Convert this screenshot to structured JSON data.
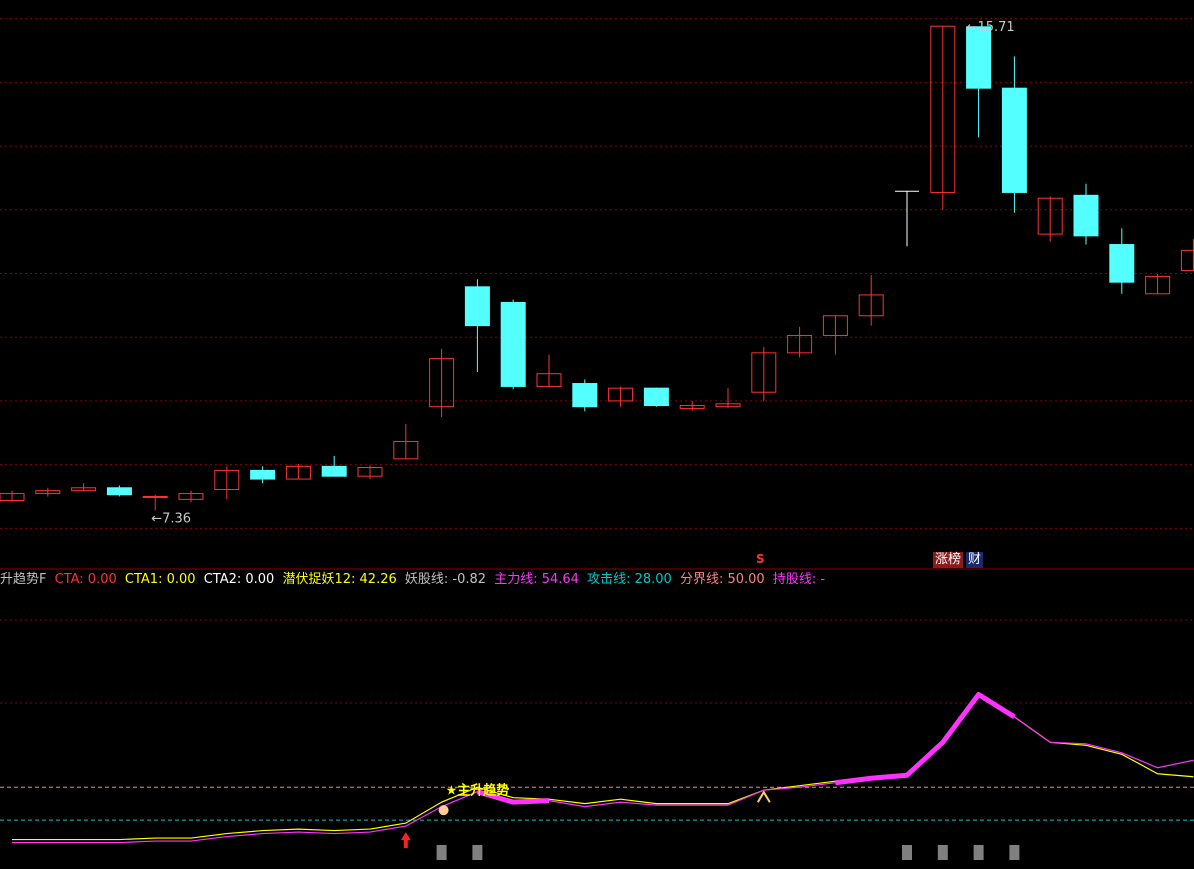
{
  "chart_data": [
    {
      "type": "candlestick",
      "ylim": [
        6.9,
        16.0
      ],
      "y_gridlines": [
        7.05,
        8.15,
        9.25,
        10.35,
        11.45,
        12.55,
        13.65,
        14.75,
        15.85
      ],
      "candles": [
        {
          "open": 7.53,
          "close": 7.65,
          "high": 7.7,
          "low": 7.5
        },
        {
          "open": 7.65,
          "close": 7.7,
          "high": 7.75,
          "low": 7.6
        },
        {
          "open": 7.7,
          "close": 7.75,
          "high": 7.83,
          "low": 7.7
        },
        {
          "open": 7.75,
          "close": 7.63,
          "high": 7.79,
          "low": 7.6
        },
        {
          "open": 7.6,
          "close": 7.6,
          "high": 7.63,
          "low": 7.36
        },
        {
          "open": 7.55,
          "close": 7.65,
          "high": 7.7,
          "low": 7.5
        },
        {
          "open": 7.72,
          "close": 8.05,
          "high": 8.12,
          "low": 7.55
        },
        {
          "open": 8.05,
          "close": 7.9,
          "high": 8.12,
          "low": 7.83
        },
        {
          "open": 7.9,
          "close": 8.12,
          "high": 8.16,
          "low": 7.9
        },
        {
          "open": 8.12,
          "close": 7.95,
          "high": 8.3,
          "low": 7.95
        },
        {
          "open": 7.95,
          "close": 8.1,
          "high": 8.14,
          "low": 7.9
        },
        {
          "open": 8.25,
          "close": 8.55,
          "high": 8.85,
          "low": 8.25
        },
        {
          "open": 9.15,
          "close": 9.98,
          "high": 10.15,
          "low": 8.97
        },
        {
          "open": 11.22,
          "close": 10.55,
          "high": 11.35,
          "low": 9.75
        },
        {
          "open": 10.95,
          "close": 9.5,
          "high": 11.0,
          "low": 9.45
        },
        {
          "open": 9.5,
          "close": 9.72,
          "high": 10.05,
          "low": 9.5
        },
        {
          "open": 9.55,
          "close": 9.15,
          "high": 9.62,
          "low": 9.07
        },
        {
          "open": 9.25,
          "close": 9.47,
          "high": 9.5,
          "low": 9.15
        },
        {
          "open": 9.47,
          "close": 9.17,
          "high": 9.48,
          "low": 9.15
        },
        {
          "open": 9.12,
          "close": 9.17,
          "high": 9.25,
          "low": 9.08
        },
        {
          "open": 9.15,
          "close": 9.2,
          "high": 9.47,
          "low": 9.13
        },
        {
          "open": 9.4,
          "close": 10.08,
          "high": 10.18,
          "low": 9.25
        },
        {
          "open": 10.08,
          "close": 10.38,
          "high": 10.53,
          "low": 10.0
        },
        {
          "open": 10.38,
          "close": 10.72,
          "high": 10.72,
          "low": 10.05
        },
        {
          "open": 10.72,
          "close": 11.08,
          "high": 11.42,
          "low": 10.55
        },
        {
          "open": 12.87,
          "close": 12.87,
          "high": 12.87,
          "low": 11.92
        },
        {
          "open": 12.85,
          "close": 15.72,
          "high": 15.72,
          "low": 12.55
        },
        {
          "open": 15.71,
          "close": 14.65,
          "high": 15.71,
          "low": 13.8
        },
        {
          "open": 14.65,
          "close": 12.85,
          "high": 15.2,
          "low": 12.5
        },
        {
          "open": 12.13,
          "close": 12.75,
          "high": 12.78,
          "low": 12.0
        },
        {
          "open": 12.8,
          "close": 12.1,
          "high": 13.0,
          "low": 11.95
        },
        {
          "open": 11.95,
          "close": 11.3,
          "high": 12.23,
          "low": 11.1
        },
        {
          "open": 11.1,
          "close": 11.4,
          "high": 11.44,
          "low": 11.1
        },
        {
          "open": 11.5,
          "close": 11.85,
          "high": 12.05,
          "low": 11.5
        }
      ],
      "annotations": [
        {
          "text": "←7.36",
          "candle": 4,
          "value": 7.36
        },
        {
          "text": "←15.71",
          "candle": 27,
          "value": 15.71
        }
      ],
      "colors": {
        "up": "#ff3232",
        "down": "#54ffff",
        "doji": "#ffffff",
        "grid": "#8b0000"
      }
    },
    {
      "type": "line",
      "ylim": [
        0,
        100
      ],
      "reference_lines": [
        {
          "name": "攻击线",
          "value": 28.0,
          "color": "#00c8c8"
        },
        {
          "name": "分界线",
          "value": 50.0,
          "color": "#ff8080"
        }
      ],
      "series": [
        {
          "name": "潜伏捉妖12",
          "color": "#ffff00",
          "values": [
            15,
            15,
            15,
            15,
            16,
            16,
            19,
            21,
            22,
            21,
            22,
            26,
            40,
            50,
            43,
            42,
            39,
            42,
            39,
            39,
            39,
            48,
            51,
            54,
            56,
            58,
            80,
            111,
            97,
            80,
            78,
            72,
            59,
            57
          ]
        },
        {
          "name": "主力线",
          "color": "#ff32ff",
          "values": [
            13,
            13,
            13,
            13,
            14,
            14,
            17,
            19,
            20,
            19,
            20,
            24,
            37,
            47,
            40,
            41,
            37,
            40,
            38,
            38,
            38,
            48,
            50,
            53,
            56,
            58,
            80,
            112,
            97,
            80,
            79,
            73,
            63,
            68
          ]
        }
      ],
      "bold_segments": [
        [
          13,
          15
        ],
        [
          23,
          28
        ]
      ],
      "signals": [
        {
          "text": "★主升趋势",
          "candle": 12,
          "color": "#ffff00"
        }
      ],
      "bars": [
        12,
        13,
        25,
        26,
        27,
        28
      ]
    }
  ],
  "indicator_bar": {
    "name": "升趋势F",
    "items": [
      {
        "label": "CTA: 0.00",
        "color": "#ff3232"
      },
      {
        "label": "CTA1: 0.00",
        "color": "#ffff00"
      },
      {
        "label": "CTA2: 0.00",
        "color": "#ffffff"
      },
      {
        "label": "潜伏捉妖12: 42.26",
        "color": "#ffff00"
      },
      {
        "label": "妖股线: -0.82",
        "color": "#c0c0c0"
      },
      {
        "label": "主力线: 54.64",
        "color": "#ff32ff"
      },
      {
        "label": "攻击线: 28.00",
        "color": "#00c8c8"
      },
      {
        "label": "分界线: 50.00",
        "color": "#ff8080"
      },
      {
        "label": "持股线: -",
        "color": "#ff32ff"
      }
    ]
  },
  "badges": {
    "zhangbang": "涨榜",
    "cai": "财",
    "signal": "S"
  }
}
